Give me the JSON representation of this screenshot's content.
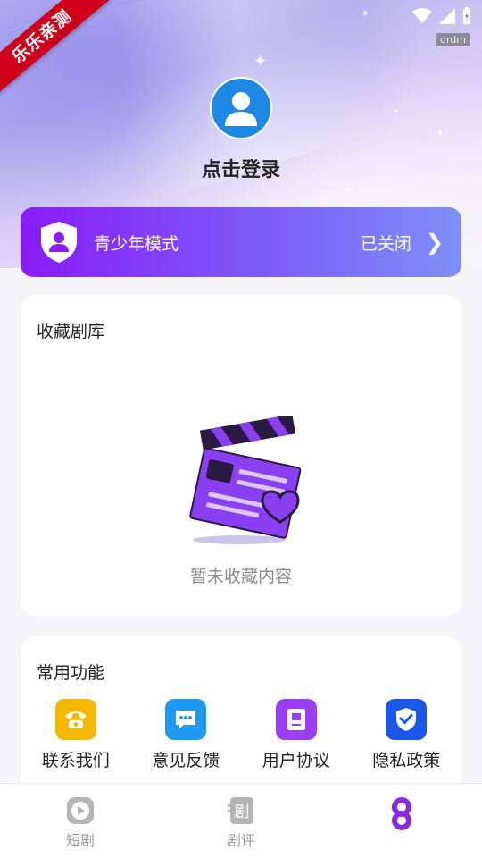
{
  "watermark": "乐乐亲测",
  "status_bar": {
    "tag": "drdm"
  },
  "profile": {
    "login_text": "点击登录"
  },
  "teen_mode": {
    "title": "青少年模式",
    "status": "已关闭",
    "colors": [
      "#8a1cf7",
      "#7f8ff7"
    ]
  },
  "favorites": {
    "title": "收藏剧库",
    "empty_text": "暂未收藏内容"
  },
  "functions": {
    "title": "常用功能",
    "items": [
      {
        "label": "联系我们",
        "icon": "phone-icon",
        "color": "#f5b800"
      },
      {
        "label": "意见反馈",
        "icon": "chat-icon",
        "color": "#1e9bf0"
      },
      {
        "label": "用户协议",
        "icon": "document-icon",
        "color": "#9b3df2"
      },
      {
        "label": "隐私政策",
        "icon": "shield-check-icon",
        "color": "#1a56e8"
      }
    ]
  },
  "tabbar": {
    "items": [
      {
        "label": "短剧",
        "icon": "play-icon"
      },
      {
        "label": "剧评",
        "icon": "review-icon"
      },
      {
        "label": "",
        "icon": "mine-icon",
        "active": true
      }
    ]
  }
}
